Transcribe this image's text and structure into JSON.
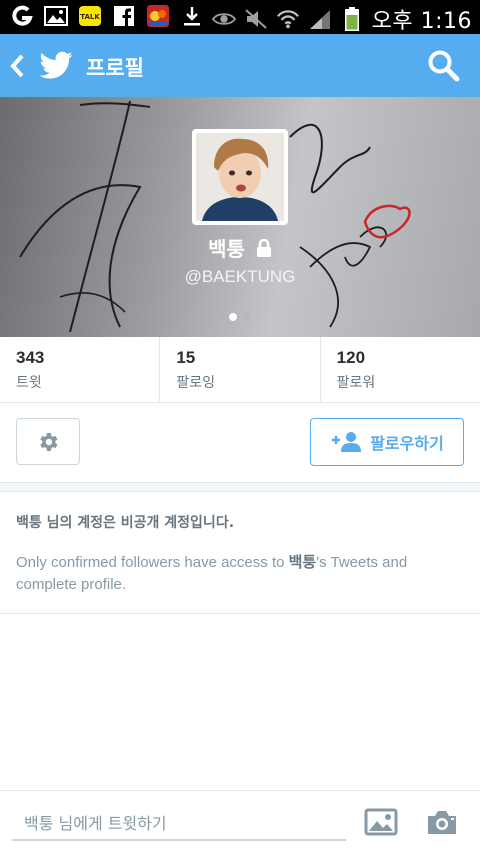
{
  "status_bar": {
    "carrier": "오후",
    "time": "1:16",
    "left_icons": [
      "g-app-icon",
      "gallery-icon",
      "kakaotalk-icon",
      "facebook-icon",
      "game-icon",
      "download-icon"
    ],
    "right_icons": [
      "eye-icon",
      "mute-icon",
      "wifi-icon",
      "signal-icon",
      "battery-icon"
    ],
    "kakaotalk_label": "TALK"
  },
  "app_bar": {
    "title": "프로필",
    "back_icon": "back-chevron-icon",
    "logo_icon": "twitter-bird-icon",
    "search_icon": "search-icon",
    "color": "#55acee"
  },
  "profile": {
    "name": "백퉁",
    "handle": "@BAEKTUNG",
    "lock_icon": "lock-icon",
    "page_indicator": {
      "pages": 2,
      "active": 1
    }
  },
  "stats": [
    {
      "value": "343",
      "label": "트윗"
    },
    {
      "value": "15",
      "label": "팔로잉"
    },
    {
      "value": "120",
      "label": "팔로워"
    }
  ],
  "actions": {
    "settings_icon": "gear-icon",
    "follow_label": "팔로우하기",
    "follow_icon": "add-user-icon"
  },
  "protected_notice": {
    "title": "백퉁 님의 계정은 비공개 계정입니다.",
    "body_prefix": "Only confirmed followers have access to ",
    "body_name": "백퉁",
    "body_suffix": "'s Tweets and complete profile."
  },
  "composer": {
    "placeholder": "백퉁 님에게 트윗하기",
    "photo_icon": "photo-icon",
    "camera_icon": "camera-icon"
  }
}
